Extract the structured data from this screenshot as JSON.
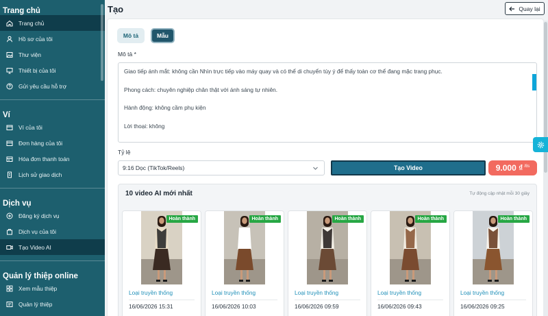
{
  "sidebar": {
    "sections": [
      {
        "title": "Trang chủ",
        "items": [
          {
            "label": "Trang chủ",
            "icon": "home-icon"
          },
          {
            "label": "Hồ sơ của tôi",
            "icon": "user-icon"
          },
          {
            "label": "Thư viện",
            "icon": "image-icon"
          },
          {
            "label": "Thiết bị của tôi",
            "icon": "monitor-icon"
          },
          {
            "label": "Gửi yêu cầu hỗ trợ",
            "icon": "help-icon"
          }
        ]
      },
      {
        "title": "Ví",
        "items": [
          {
            "label": "Ví của tôi",
            "icon": "wallet-icon"
          },
          {
            "label": "Đơn hàng của tôi",
            "icon": "order-icon"
          },
          {
            "label": "Hóa đơn thanh toán",
            "icon": "invoice-icon"
          },
          {
            "label": "Lịch sử giao dịch",
            "icon": "history-icon"
          }
        ]
      },
      {
        "title": "Dịch vụ",
        "items": [
          {
            "label": "Đăng ký dịch vụ",
            "icon": "plus-circle-icon"
          },
          {
            "label": "Dịch vụ của tôi",
            "icon": "box-icon"
          },
          {
            "label": "Tạo Video AI",
            "icon": "video-icon"
          }
        ]
      },
      {
        "title": "Quản lý thiệp online",
        "items": [
          {
            "label": "Xem mẫu thiệp",
            "icon": "grid-icon"
          },
          {
            "label": "Quản lý thiệp",
            "icon": "card-icon"
          }
        ]
      }
    ]
  },
  "header": {
    "title": "Tạo",
    "back_label": "Quay lại"
  },
  "tabs": {
    "mota": "Mô tả",
    "mau": "Mẫu"
  },
  "description": {
    "label": "Mô tả *",
    "lines": [
      "Giao tiếp ánh mắt: không cần Nhìn trực tiếp vào máy quay và có thể di chuyển tùy ý để thấy toàn cơ thể đang mặc trang phục.",
      "Phong cách: chuyên nghiệp chân thật với ánh sáng tự nhiên.",
      "Hành động: không cầm phụ kiện",
      "Lời thoại: không"
    ]
  },
  "ratio": {
    "label": "Tỷ lệ",
    "value": "9:16 Dọc (TikTok/Reels)"
  },
  "create_button": "Tạo Video",
  "price": {
    "value": "9.000 ₫",
    "unit": "/8s"
  },
  "videos": {
    "title": "10 video AI mới nhất",
    "auto_refresh": "Tự động cập nhật mỗi 30 giây",
    "items": [
      {
        "status": "Hoàn thành",
        "type": "Loại truyền thống",
        "date": "16/06/2026 15:31",
        "bg": "#d9d2c4",
        "top": "#e8dcc6",
        "skirt": "#3a2a22",
        "vest": "#2b2b2b"
      },
      {
        "status": "Hoàn thành",
        "type": "Loại truyền thống",
        "date": "16/06/2026 10:03",
        "bg": "#c7c2b8",
        "top": "#ffffff",
        "skirt": "#7a4a2c",
        "vest": "#ffffff"
      },
      {
        "status": "Hoàn thành",
        "type": "Loại truyền thống",
        "date": "16/06/2026 09:59",
        "bg": "#b7b0a4",
        "top": "#f3efe6",
        "skirt": "#6b4a35",
        "vest": "#2a2422"
      },
      {
        "status": "Hoàn thành",
        "type": "Loại truyền thống",
        "date": "16/06/2026 09:43",
        "bg": "#c8c0b2",
        "top": "#f2ece1",
        "skirt": "#7a4b30",
        "vest": "#8b5a3a"
      },
      {
        "status": "Hoàn thành",
        "type": "Loại truyền thống",
        "date": "16/06/2026 09:25",
        "bg": "#cdd2d6",
        "top": "#f7f2ea",
        "skirt": "#8a552f",
        "vest": "#6c3f26"
      }
    ]
  },
  "colors": {
    "sidebar": "#1d5f6e",
    "accent": "#1f6e8c",
    "price": "#f26a5f",
    "success": "#27a744"
  }
}
